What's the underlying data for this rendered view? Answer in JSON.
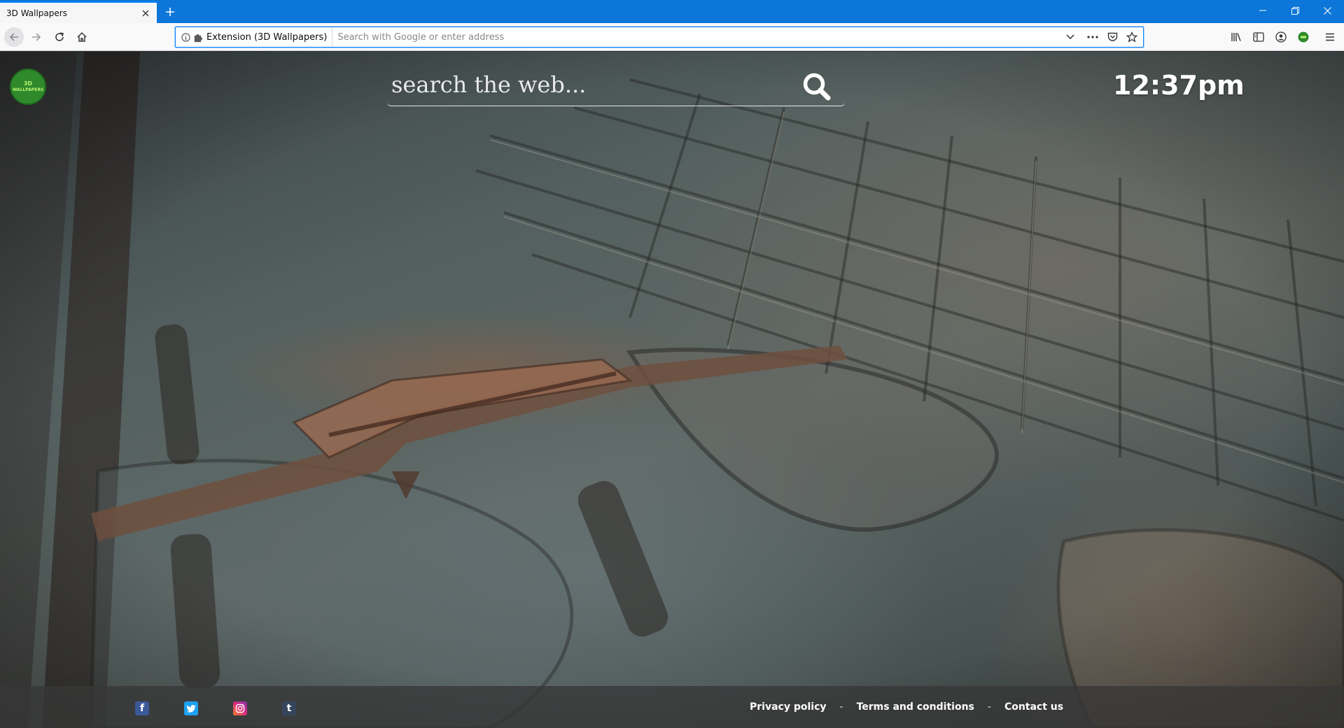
{
  "browser": {
    "tab_title": "3D Wallpapers",
    "identity_label": "Extension (3D Wallpapers)",
    "url_placeholder": "Search with Google or enter address",
    "chrome_accent": "#0a84ff",
    "titlebar_color": "#0c77d8"
  },
  "page": {
    "logo_text_line1": "3D",
    "logo_text_line2": "WALLPAPERS",
    "search_placeholder": "search the web...",
    "clock": "12:37pm"
  },
  "footer": {
    "social_icons": [
      "facebook-icon",
      "twitter-icon",
      "instagram-icon",
      "tumblr-icon"
    ],
    "links": [
      "Privacy policy",
      "Terms and conditions",
      "Contact us"
    ],
    "separator": "-"
  }
}
